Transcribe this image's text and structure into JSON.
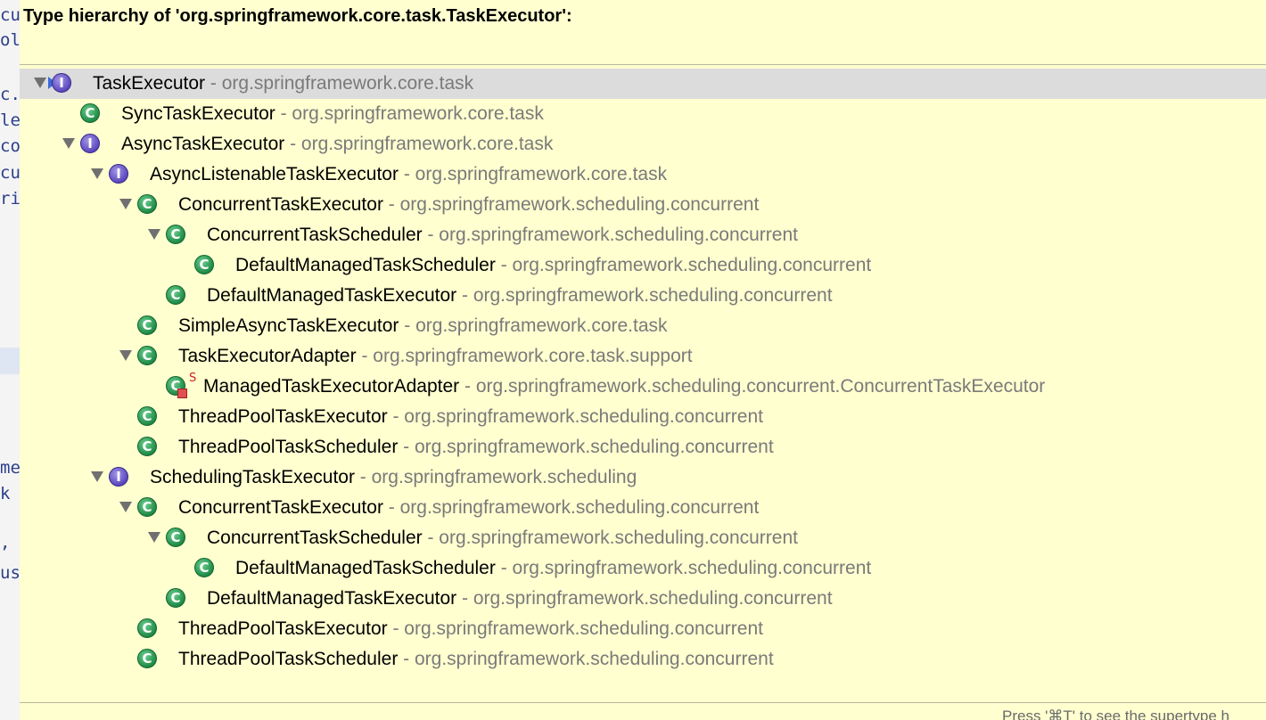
{
  "background_editor": {
    "visible_fragments": [
      "cu",
      "ol",
      "c.",
      "le",
      "co",
      "cu",
      "ri",
      "me",
      "k",
      ",",
      "us"
    ]
  },
  "popup": {
    "title": "Type hierarchy of 'org.springframework.core.task.TaskExecutor':",
    "status_hint": "Press '⌘T' to see the supertype h"
  },
  "tree": [
    {
      "name": "TaskExecutor",
      "pkg": " - org.springframework.core.task",
      "kind": "interface-icon",
      "expanded": true,
      "selected": true
    },
    {
      "name": "SyncTaskExecutor",
      "pkg": " - org.springframework.core.task",
      "kind": "class-icon",
      "expanded": false
    },
    {
      "name": "AsyncTaskExecutor",
      "pkg": " - org.springframework.core.task",
      "kind": "interface-icon",
      "expanded": true
    },
    {
      "name": "AsyncListenableTaskExecutor",
      "pkg": " - org.springframework.core.task",
      "kind": "interface-icon",
      "expanded": true
    },
    {
      "name": "ConcurrentTaskExecutor",
      "pkg": " - org.springframework.scheduling.concurrent",
      "kind": "class-icon",
      "expanded": true
    },
    {
      "name": "ConcurrentTaskScheduler",
      "pkg": " - org.springframework.scheduling.concurrent",
      "kind": "class-icon",
      "expanded": true
    },
    {
      "name": "DefaultManagedTaskScheduler",
      "pkg": " - org.springframework.scheduling.concurrent",
      "kind": "class-icon",
      "expanded": false
    },
    {
      "name": "DefaultManagedTaskExecutor",
      "pkg": " - org.springframework.scheduling.concurrent",
      "kind": "class-icon",
      "expanded": false
    },
    {
      "name": "SimpleAsyncTaskExecutor",
      "pkg": " - org.springframework.core.task",
      "kind": "class-icon",
      "expanded": false
    },
    {
      "name": "TaskExecutorAdapter",
      "pkg": " - org.springframework.core.task.support",
      "kind": "class-icon",
      "expanded": true
    },
    {
      "name": "ManagedTaskExecutorAdapter",
      "pkg": " - org.springframework.scheduling.concurrent.ConcurrentTaskExecutor",
      "kind": "class-icon",
      "expanded": false,
      "badge": "S"
    },
    {
      "name": "ThreadPoolTaskExecutor",
      "pkg": " - org.springframework.scheduling.concurrent",
      "kind": "class-icon",
      "expanded": false
    },
    {
      "name": "ThreadPoolTaskScheduler",
      "pkg": " - org.springframework.scheduling.concurrent",
      "kind": "class-icon",
      "expanded": false
    },
    {
      "name": "SchedulingTaskExecutor",
      "pkg": " - org.springframework.scheduling",
      "kind": "interface-icon",
      "expanded": true
    },
    {
      "name": "ConcurrentTaskExecutor",
      "pkg": " - org.springframework.scheduling.concurrent",
      "kind": "class-icon",
      "expanded": true
    },
    {
      "name": "ConcurrentTaskScheduler",
      "pkg": " - org.springframework.scheduling.concurrent",
      "kind": "class-icon",
      "expanded": true
    },
    {
      "name": "DefaultManagedTaskScheduler",
      "pkg": " - org.springframework.scheduling.concurrent",
      "kind": "class-icon",
      "expanded": false
    },
    {
      "name": "DefaultManagedTaskExecutor",
      "pkg": " - org.springframework.scheduling.concurrent",
      "kind": "class-icon",
      "expanded": false
    },
    {
      "name": "ThreadPoolTaskExecutor",
      "pkg": " - org.springframework.scheduling.concurrent",
      "kind": "class-icon",
      "expanded": false
    },
    {
      "name": "ThreadPoolTaskScheduler",
      "pkg": " - org.springframework.scheduling.concurrent",
      "kind": "class-icon",
      "expanded": false
    }
  ],
  "colors": {
    "popup_background": "#ffffd0",
    "selected_row": "#dcdcdc",
    "package_text": "#7a7a7a",
    "class_icon": "#1f8a46",
    "interface_icon": "#5b47bd"
  }
}
